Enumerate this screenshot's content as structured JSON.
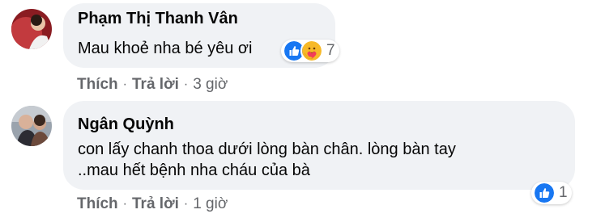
{
  "comments": [
    {
      "author": "Phạm Thị Thanh Vân",
      "lines": [
        "Mau khoẻ nha bé yêu ơi"
      ],
      "reactions": {
        "icons": [
          "like-icon",
          "care-icon"
        ],
        "count": "7"
      },
      "actions": {
        "like": "Thích",
        "reply": "Trả lời",
        "separator": "·",
        "time": "3 giờ"
      }
    },
    {
      "author": "Ngân Quỳnh",
      "lines": [
        "con lấy chanh thoa dưới lòng bàn chân. lòng bàn tay",
        "..mau hết bệnh nha cháu của bà"
      ],
      "reactions": {
        "icons": [
          "like-icon"
        ],
        "count": "1"
      },
      "actions": {
        "like": "Thích",
        "reply": "Trả lời",
        "separator": "·",
        "time": "1 giờ"
      }
    }
  ],
  "colors": {
    "bubble": "#f0f2f5",
    "secondary_text": "#65676b",
    "like_blue": "#1877f2",
    "care_yellow": "#f7b928"
  }
}
